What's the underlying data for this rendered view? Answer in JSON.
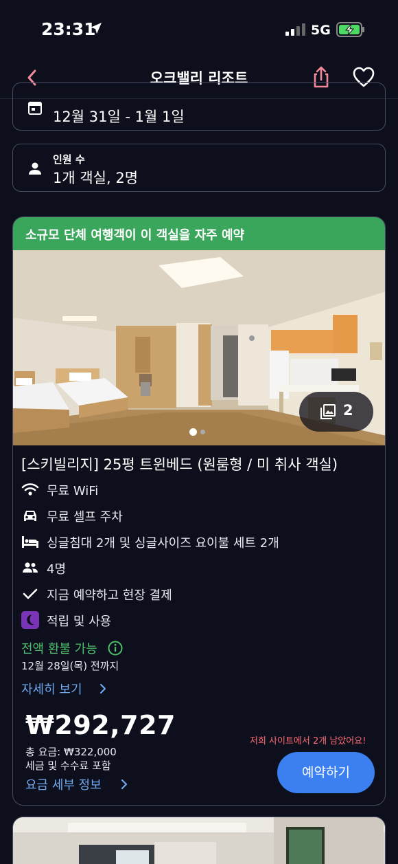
{
  "status_bar": {
    "time": "23:31",
    "network": "5G"
  },
  "header": {
    "title": "오크밸리 리조트"
  },
  "dates": {
    "value": "12월 31일 - 1월 1일"
  },
  "guests": {
    "label": "인원 수",
    "value": "1개 객실, 2명"
  },
  "room": {
    "banner": "소규모 단체 여행객이 이 객실을 자주 예약",
    "photo_count": "2",
    "name": "[스키빌리지] 25평 트윈베드 (원룸형 / 미 취사 객실)",
    "amenities": [
      {
        "icon": "wifi-icon",
        "text": "무료 WiFi"
      },
      {
        "icon": "car-icon",
        "text": "무료 셀프 주차"
      },
      {
        "icon": "bed-icon",
        "text": "싱글침대 2개 및 싱글사이즈 요이불 세트 2개"
      },
      {
        "icon": "people-icon",
        "text": "4명"
      },
      {
        "icon": "check-icon",
        "text": "지금 예약하고 현장 결제"
      },
      {
        "icon": "moon-icon",
        "text": "적립 및 사용"
      }
    ],
    "refund": "전액 환불 가능",
    "refund_date": "12월 28일(목) 전까지",
    "details_link": "자세히 보기",
    "price": "₩292,727",
    "total": "총 요금: ₩322,000",
    "tax_note": "세금 및 수수료 포함",
    "price_details_link": "요금 세부 정보",
    "remaining": "저희 사이트에서 2개 남았어요!",
    "book_button": "예약하기"
  },
  "colors": {
    "background": "#0e0f1c",
    "banner_green": "#3aa65b",
    "refund_green": "#4ec06c",
    "link_blue": "#6fa9ee",
    "button_blue": "#3b7ff0",
    "alert_red": "#ff6b74",
    "accent_pink": "#f08a9a"
  }
}
